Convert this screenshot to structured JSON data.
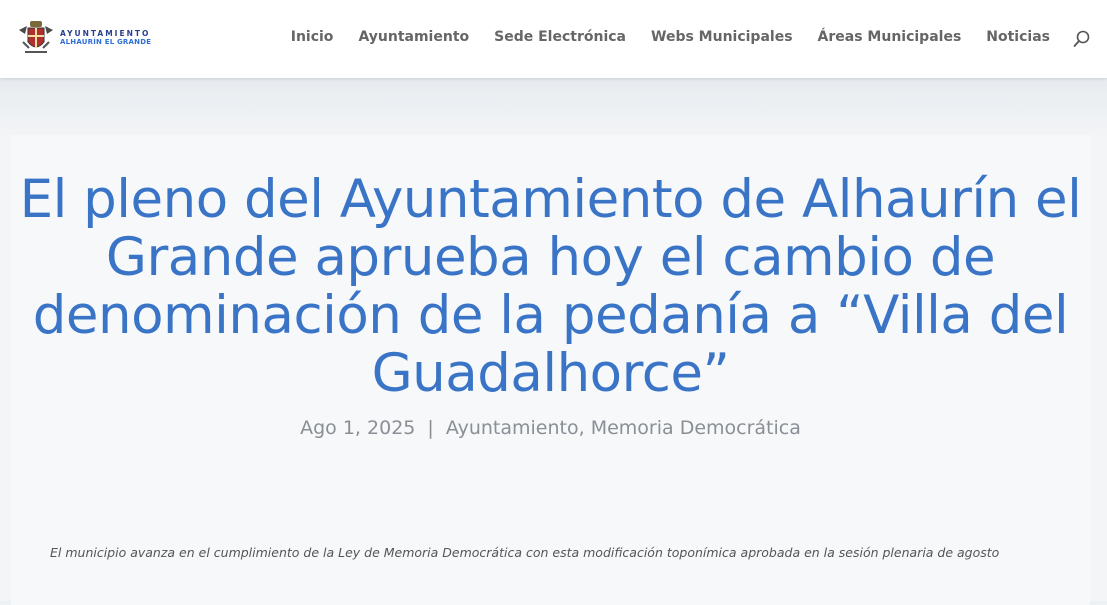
{
  "header": {
    "logo": {
      "line1": "AYUNTAMIENTO",
      "line2": "ALHAURÍN EL GRANDE"
    },
    "nav": [
      "Inicio",
      "Ayuntamiento",
      "Sede Electrónica",
      "Webs Municipales",
      "Áreas Municipales",
      "Noticias"
    ],
    "search_icon": "search-icon"
  },
  "article": {
    "title": "El pleno del Ayuntamiento de Alhaurín el Grande aprueba hoy el cambio de denominación de la pedanía a “Villa del Guadalhorce”",
    "date": "Ago 1, 2025",
    "separator": "|",
    "category1": "Ayuntamiento",
    "category_sep": ", ",
    "category2": "Memoria Democrática",
    "excerpt": "El municipio avanza en el cumplimiento de la Ley de Memoria Democrática con esta modificación toponímica aprobada en la sesión plenaria de agosto"
  },
  "colors": {
    "title": "#3a74c6",
    "nav": "#666666",
    "meta": "#8a8f96",
    "logo_dark": "#2a3f8f",
    "logo_light": "#2f6fd8"
  }
}
